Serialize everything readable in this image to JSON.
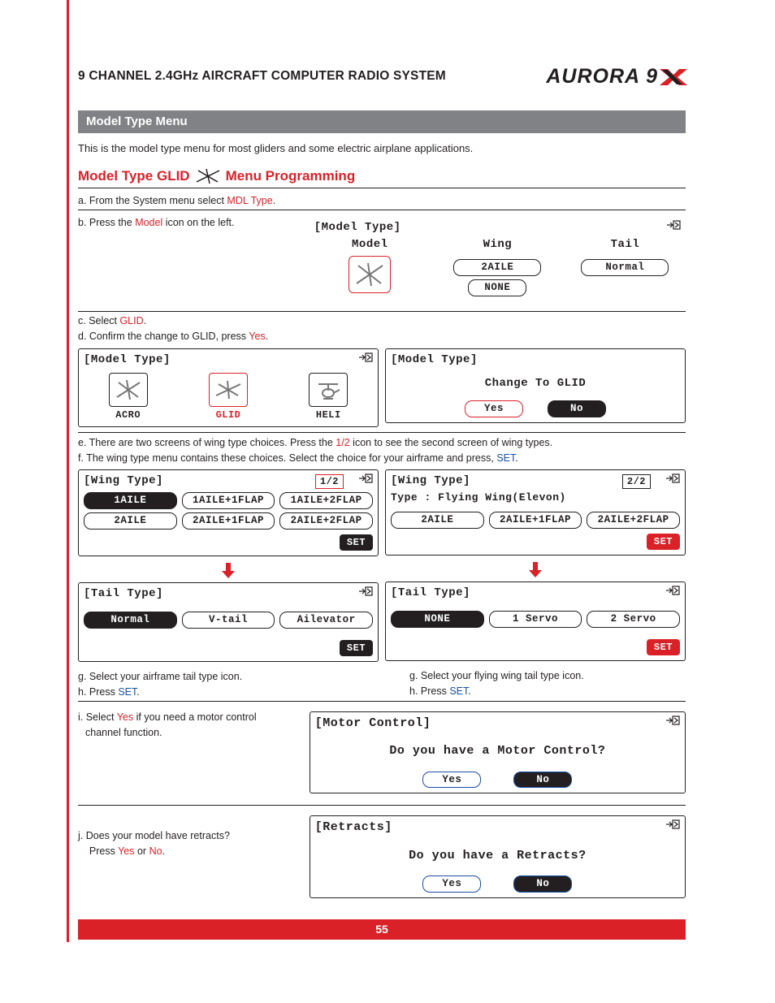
{
  "header": {
    "title": "9 CHANNEL 2.4GHz AIRCRAFT COMPUTER RADIO SYSTEM",
    "logo_text": "AURORA 9"
  },
  "section_bar": "Model Type Menu",
  "intro": "This is the model type menu for most gliders and some electric airplane applications.",
  "subhead": {
    "left": "Model Type GLID",
    "right": "Menu Programming"
  },
  "steps": {
    "a_pre": "a. From the System menu select ",
    "a_hl": "MDL Type",
    "a_post": ".",
    "b_pre": "b. Press the ",
    "b_hl": "Model",
    "b_post": " icon on the left.",
    "c_pre": "c. Select ",
    "c_hl": "GLID",
    "c_post": ".",
    "d_pre": "d. Confirm the change to GLID, press ",
    "d_hl": "Yes",
    "d_post": ".",
    "e_pre": "e. There are two screens of wing type choices. Press the ",
    "e_hl": "1/2",
    "e_post": " icon to see the second screen of wing types.",
    "f_pre": "f. The wing type menu contains these choices. Select the choice for your airframe and press, ",
    "f_hl": "SET",
    "f_post": ".",
    "g1": "g. Select your airframe tail type icon.",
    "g2": "g. Select your flying wing tail type icon.",
    "h_pre": "h. Press ",
    "h_hl": "SET",
    "h_post": ".",
    "i_pre": "i. Select ",
    "i_hl": "Yes",
    "i_post": " if you need a motor control",
    "i_line2": "channel function.",
    "j1": "j. Does your model have retracts?",
    "j2_pre": "    Press ",
    "j2_hl1": "Yes",
    "j2_mid": " or ",
    "j2_hl2": "No",
    "j2_post": "."
  },
  "lcd": {
    "model_type": "[Model Type]",
    "wing_type": "[Wing Type]",
    "tail_type": "[Tail Type]",
    "motor": "[Motor Control]",
    "retracts": "[Retracts]",
    "cols": {
      "model": "Model",
      "wing": "Wing",
      "tail": "Tail"
    },
    "vals": {
      "wing1": "2AILE",
      "wing2": "NONE",
      "tail": "Normal"
    },
    "icons": {
      "acro": "ACRO",
      "glid": "GLID",
      "heli": "HELI"
    },
    "change_to": "Change To GLID",
    "yes": "Yes",
    "no": "No",
    "page12": "1/2",
    "page22": "2/2",
    "set": "SET",
    "wing_opts1": [
      "1AILE",
      "1AILE+1FLAP",
      "1AILE+2FLAP",
      "2AILE",
      "2AILE+1FLAP",
      "2AILE+2FLAP"
    ],
    "wing2_sub": "Type : Flying Wing(Elevon)",
    "wing_opts2": [
      "2AILE",
      "2AILE+1FLAP",
      "2AILE+2FLAP"
    ],
    "tail_opts1": [
      "Normal",
      "V-tail",
      "Ailevator"
    ],
    "tail_opts2": [
      "NONE",
      "1 Servo",
      "2 Servo"
    ],
    "motor_q": "Do you have a Motor Control?",
    "retracts_q": "Do you have a Retracts?"
  },
  "page_number": "55"
}
